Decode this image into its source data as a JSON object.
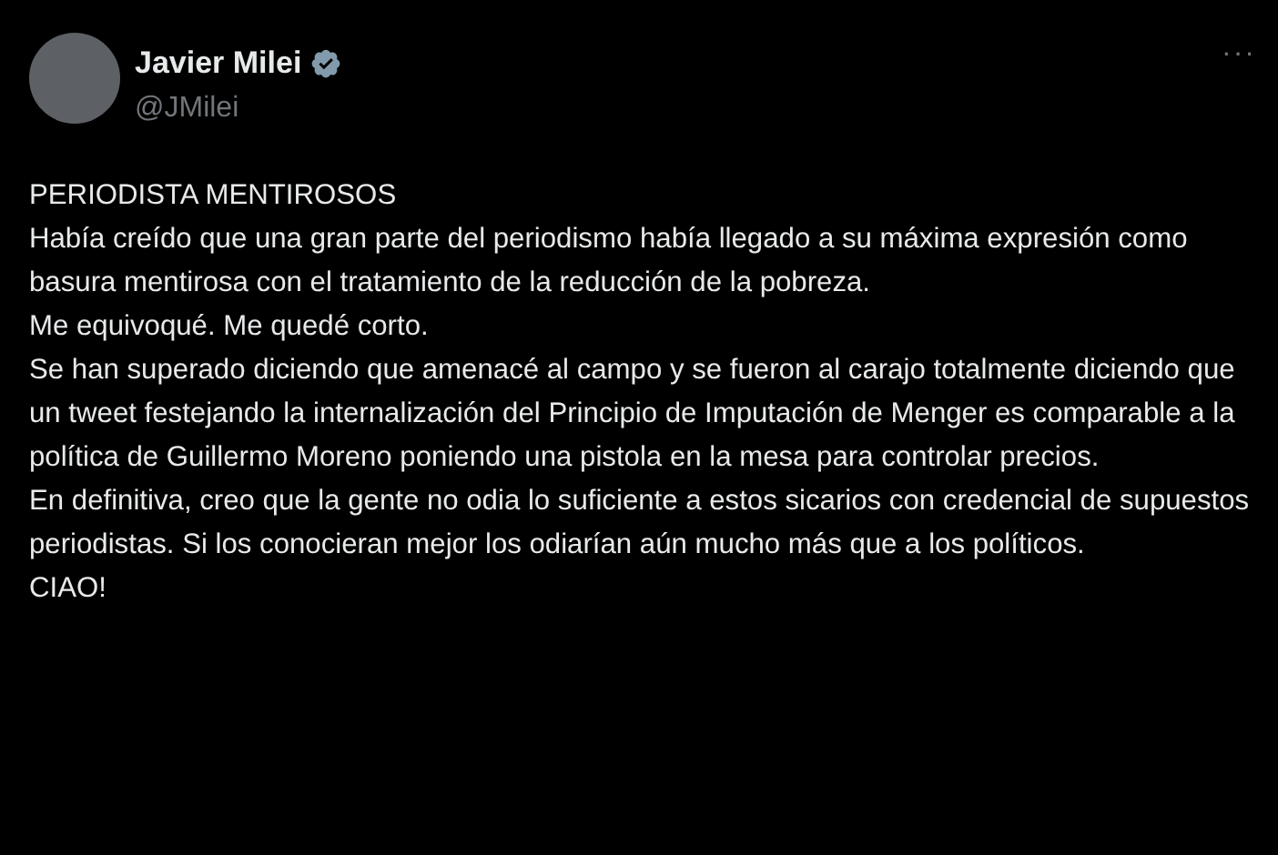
{
  "author": {
    "name": "Javier Milei",
    "verified": true,
    "handle": "@JMilei"
  },
  "more_menu": "···",
  "paragraphs": [
    "PERIODISTA MENTIROSOS",
    "Había creído que una gran parte del periodismo había llegado a su máxima expresión como basura mentirosa con el tratamiento de la reducción de la pobreza.",
    "Me equivoqué. Me quedé corto.",
    "Se han superado diciendo que amenacé al campo y se fueron al carajo totalmente diciendo que un tweet festejando la internalización del Principio de Imputación de Menger es comparable a la política de Guillermo Moreno poniendo una pistola en la mesa para controlar precios.",
    "En definitiva, creo que la gente no odia lo suficiente a estos sicarios con credencial de supuestos periodistas. Si los conocieran mejor los odiarían aún mucho más que a los políticos.",
    "CIAO!"
  ]
}
